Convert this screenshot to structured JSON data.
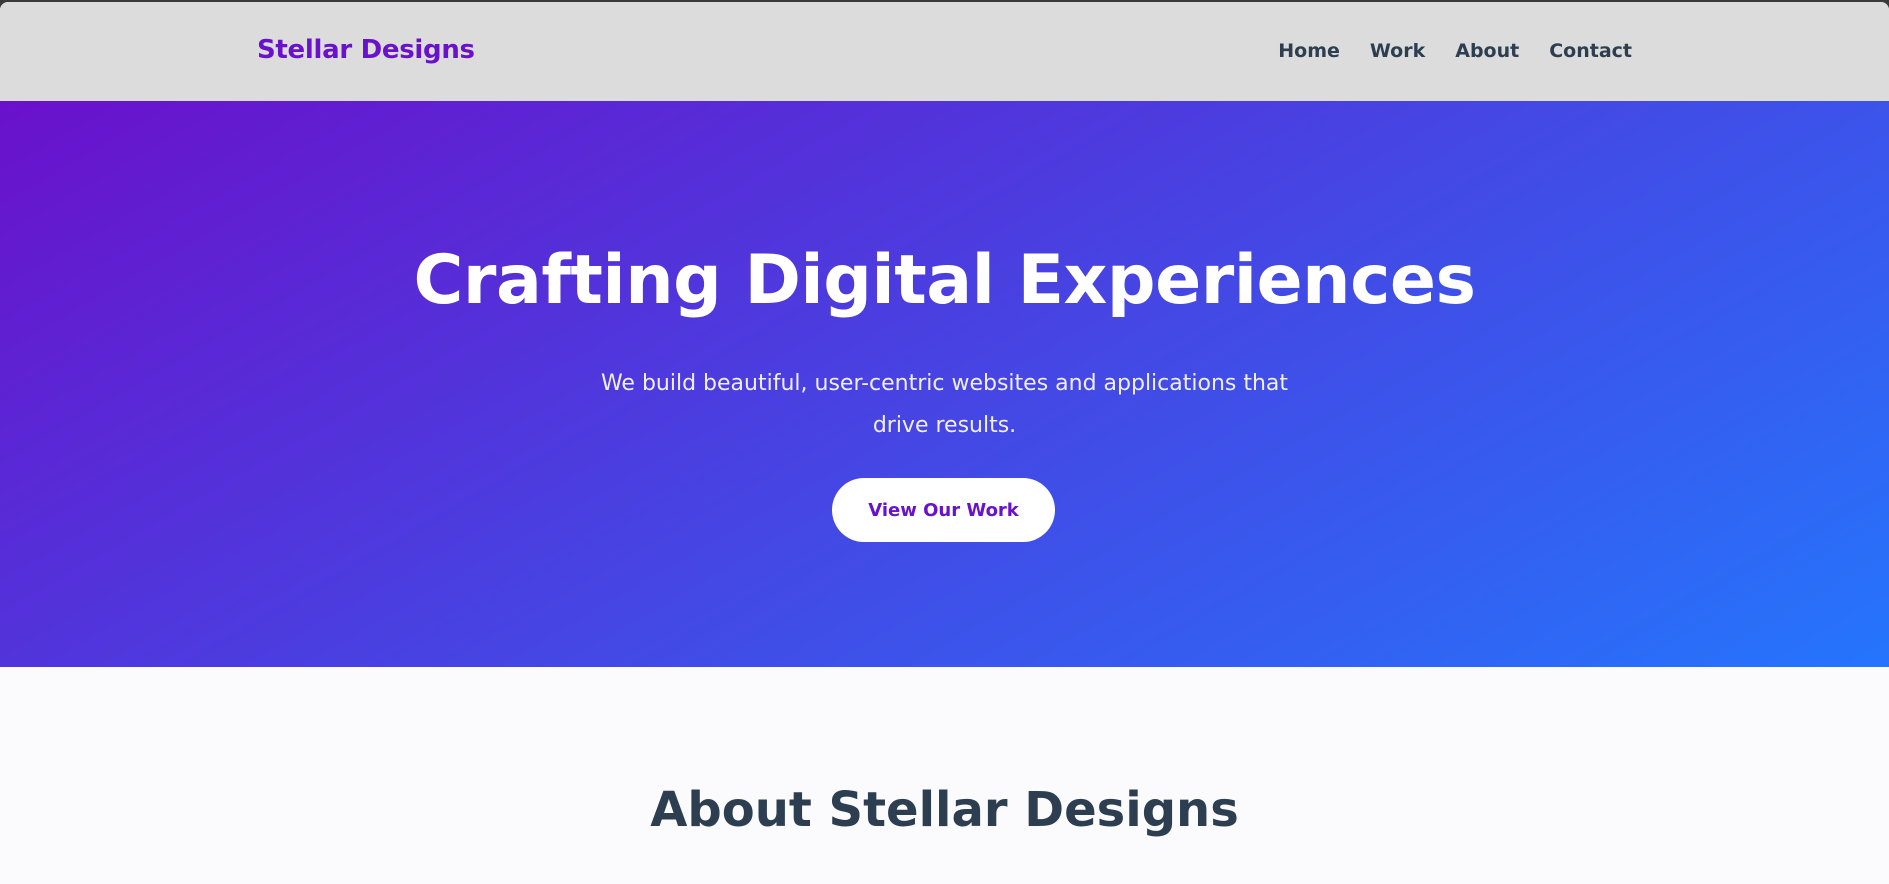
{
  "header": {
    "logo": "Stellar Designs",
    "nav": [
      {
        "label": "Home"
      },
      {
        "label": "Work"
      },
      {
        "label": "About"
      },
      {
        "label": "Contact"
      }
    ]
  },
  "hero": {
    "title": "Crafting Digital Experiences",
    "subtitle": "We build beautiful, user-centric websites and applications that drive results.",
    "cta_label": "View Our Work"
  },
  "about": {
    "title": "About Stellar Designs"
  },
  "colors": {
    "brand": "#6a11cb",
    "gradient_end": "#2575fc",
    "heading": "#2c3e50",
    "header_bg": "#dcdcdc"
  }
}
